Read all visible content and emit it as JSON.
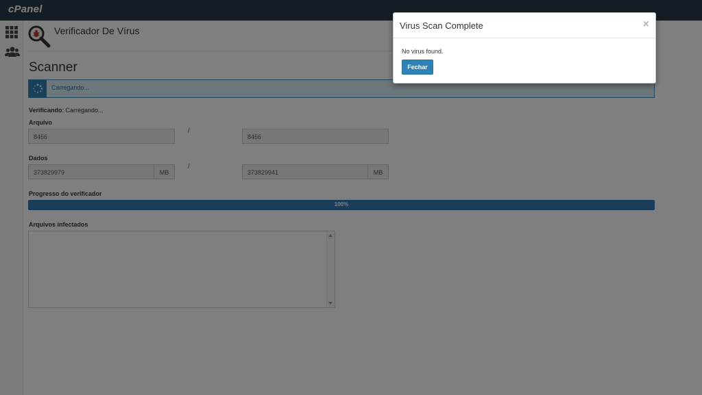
{
  "app": {
    "logo": "cPanel"
  },
  "sidebar": {
    "items": [
      {
        "icon": "grid-icon"
      },
      {
        "icon": "users-icon"
      }
    ]
  },
  "page": {
    "title": "Verificador De Vírus",
    "section_title": "Scanner"
  },
  "status": {
    "text": "Carregando..."
  },
  "scan": {
    "label": "Verificando",
    "value": ": Carregando..."
  },
  "files": {
    "label": "Arquivo",
    "scanned": "8456",
    "separator": "/",
    "total": "8456"
  },
  "data": {
    "label": "Dados",
    "scanned": "373829979",
    "scanned_unit": "MB",
    "separator": "/",
    "total": "373829941",
    "total_unit": "MB"
  },
  "progress": {
    "label": "Progresso do verificador",
    "value_text": "100%",
    "value": 1.0
  },
  "infected": {
    "label": "Arquivos infectados",
    "content": ""
  },
  "modal": {
    "title": "Virus Scan Complete",
    "close": "×",
    "message": "No virus found.",
    "button": "Fechar"
  },
  "colors": {
    "topbar": "#293a4a",
    "accent": "#2e82b5",
    "progress": "#337ab7",
    "info_bg": "#d9edf7"
  }
}
